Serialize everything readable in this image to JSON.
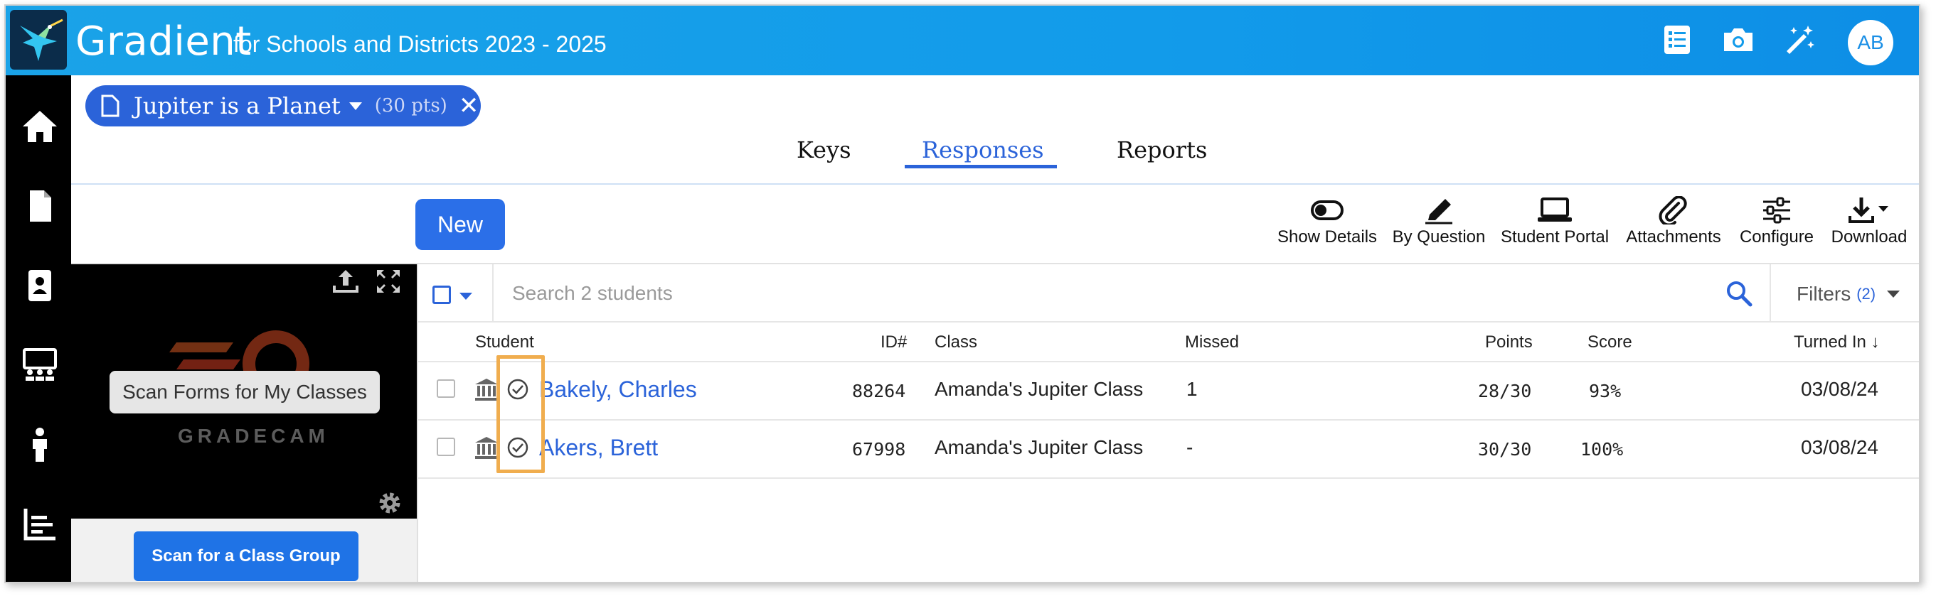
{
  "app": {
    "title": "Gradient",
    "subtitle": "for Schools and Districts 2023 - 2025",
    "avatar_initials": "AB",
    "accent_color": "#2b63d9",
    "topbar_color": "#129bea",
    "top_icons": [
      "list-icon",
      "camera-icon",
      "magic-wand-icon"
    ]
  },
  "nav": {
    "items": [
      "home-icon",
      "document-icon",
      "student-id-icon",
      "classes-icon",
      "person-icon",
      "reports-icon"
    ]
  },
  "assignment": {
    "name": "Jupiter is a Planet",
    "points": "(30 pts)",
    "close": "✕"
  },
  "tabs": [
    {
      "label": "Keys",
      "active": false
    },
    {
      "label": "Responses",
      "active": true
    },
    {
      "label": "Reports",
      "active": false
    }
  ],
  "toolbar": {
    "new_label": "New",
    "tools": [
      {
        "label": "Show Details",
        "icon": "toggle-icon"
      },
      {
        "label": "By Question",
        "icon": "pencil-icon"
      },
      {
        "label": "Student Portal",
        "icon": "laptop-icon"
      },
      {
        "label": "Attachments",
        "icon": "paperclip-icon"
      },
      {
        "label": "Configure",
        "icon": "sliders-icon"
      },
      {
        "label": "Download",
        "icon": "download-icon"
      }
    ]
  },
  "scanner": {
    "tooltip": "Scan Forms for My Classes",
    "brand": "GRADECAM",
    "group_button": "Scan for a Class Group"
  },
  "search": {
    "placeholder": "Search 2 students",
    "filters_label": "Filters",
    "filters_count": "(2)"
  },
  "table": {
    "columns": [
      "Student",
      "ID#",
      "Class",
      "Missed",
      "Points",
      "Score",
      "Turned In"
    ],
    "sort_indicator": "↓",
    "rows": [
      {
        "student": "Bakely, Charles",
        "id": "88264",
        "class": "Amanda's Jupiter Class",
        "missed": "1",
        "points": "28/30",
        "score": "93%",
        "turned_in": "03/08/24"
      },
      {
        "student": "Akers, Brett",
        "id": "67998",
        "class": "Amanda's Jupiter Class",
        "missed": "-",
        "points": "30/30",
        "score": "100%",
        "turned_in": "03/08/24"
      }
    ]
  }
}
